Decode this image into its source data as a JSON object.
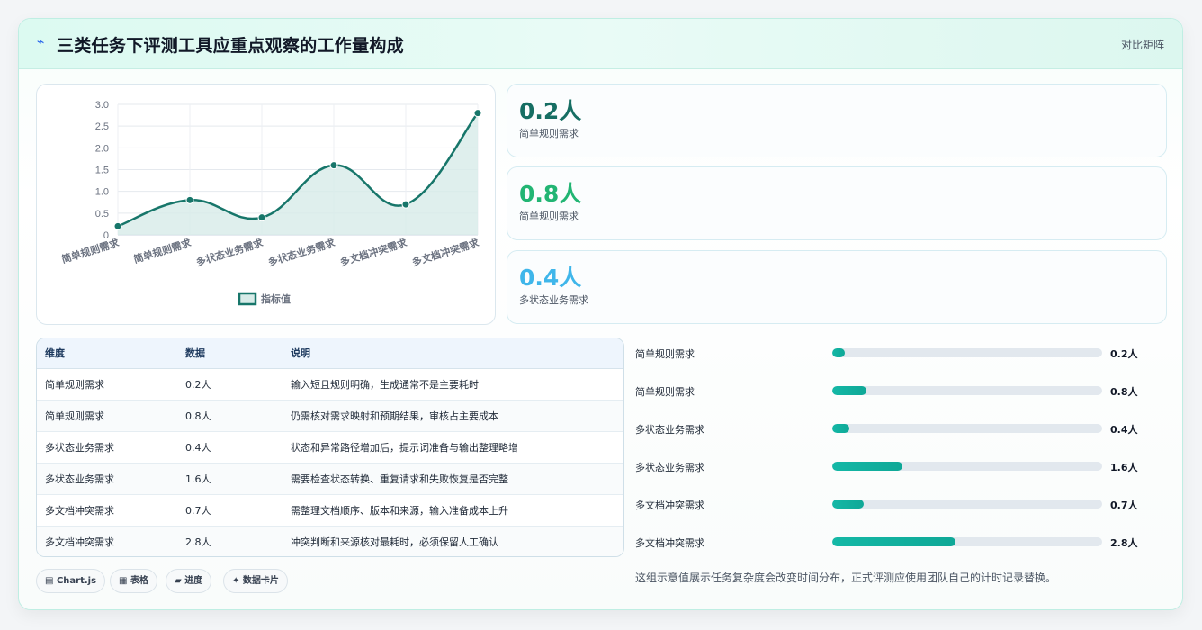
{
  "header": {
    "logo_icon": "⌁",
    "title": "三类任务下评测工具应重点观察的工作量构成",
    "action_label": "对比矩阵"
  },
  "chart_data": {
    "type": "line",
    "categories": [
      "简单规则需求",
      "简单规则需求",
      "多状态业务需求",
      "多状态业务需求",
      "多文档冲突需求",
      "多文档冲突需求"
    ],
    "series": [
      {
        "name": "指标值",
        "values": [
          0.2,
          0.8,
          0.4,
          1.6,
          0.7,
          2.8
        ]
      }
    ],
    "ylim": [
      0,
      3.0
    ],
    "yticks": [
      "0",
      "0.5",
      "1.0",
      "1.5",
      "2.0",
      "2.5",
      "3.0"
    ],
    "legend": "bottom",
    "grid": true,
    "line_color": "#17766a",
    "fill_color": "#d7ebe8"
  },
  "metrics": [
    {
      "value": "0.2人",
      "label": "简单规则需求",
      "color": "#166e63"
    },
    {
      "value": "0.8人",
      "label": "简单规则需求",
      "color": "#22b573"
    },
    {
      "value": "0.4人",
      "label": "多状态业务需求",
      "color": "#3fb6ea"
    }
  ],
  "table": {
    "headers": [
      "维度",
      "数据",
      "说明"
    ],
    "rows": [
      [
        "简单规则需求",
        "0.2人",
        "输入短且规则明确，生成通常不是主要耗时"
      ],
      [
        "简单规则需求",
        "0.8人",
        "仍需核对需求映射和预期结果，审核占主要成本"
      ],
      [
        "多状态业务需求",
        "0.4人",
        "状态和异常路径增加后，提示词准备与输出整理略增"
      ],
      [
        "多状态业务需求",
        "1.6人",
        "需要检查状态转换、重复请求和失败恢复是否完整"
      ],
      [
        "多文档冲突需求",
        "0.7人",
        "需整理文档顺序、版本和来源，输入准备成本上升"
      ],
      [
        "多文档冲突需求",
        "2.8人",
        "冲突判断和来源核对最耗时，必须保留人工确认"
      ]
    ]
  },
  "bars": [
    {
      "label": "简单规则需求",
      "value_text": "0.2人",
      "value": 0.2,
      "fraction": 0.045
    },
    {
      "label": "简单规则需求",
      "value_text": "0.8人",
      "value": 0.8,
      "fraction": 0.127
    },
    {
      "label": "多状态业务需求",
      "value_text": "0.4人",
      "value": 0.4,
      "fraction": 0.064
    },
    {
      "label": "多状态业务需求",
      "value_text": "1.6人",
      "value": 1.6,
      "fraction": 0.26
    },
    {
      "label": "多文档冲突需求",
      "value_text": "0.7人",
      "value": 0.7,
      "fraction": 0.115
    },
    {
      "label": "多文档冲突需求",
      "value_text": "2.8人",
      "value": 2.8,
      "fraction": 0.455
    }
  ],
  "note": "这组示意值展示任务复杂度会改变时间分布，正式评测应使用团队自己的计时记录替换。",
  "chips": [
    {
      "icon": "▤",
      "label": "Chart.js"
    },
    {
      "icon": "▦",
      "label": "表格"
    },
    {
      "icon": "▰",
      "label": "进度"
    },
    {
      "icon": "✦",
      "label": "数据卡片"
    }
  ]
}
